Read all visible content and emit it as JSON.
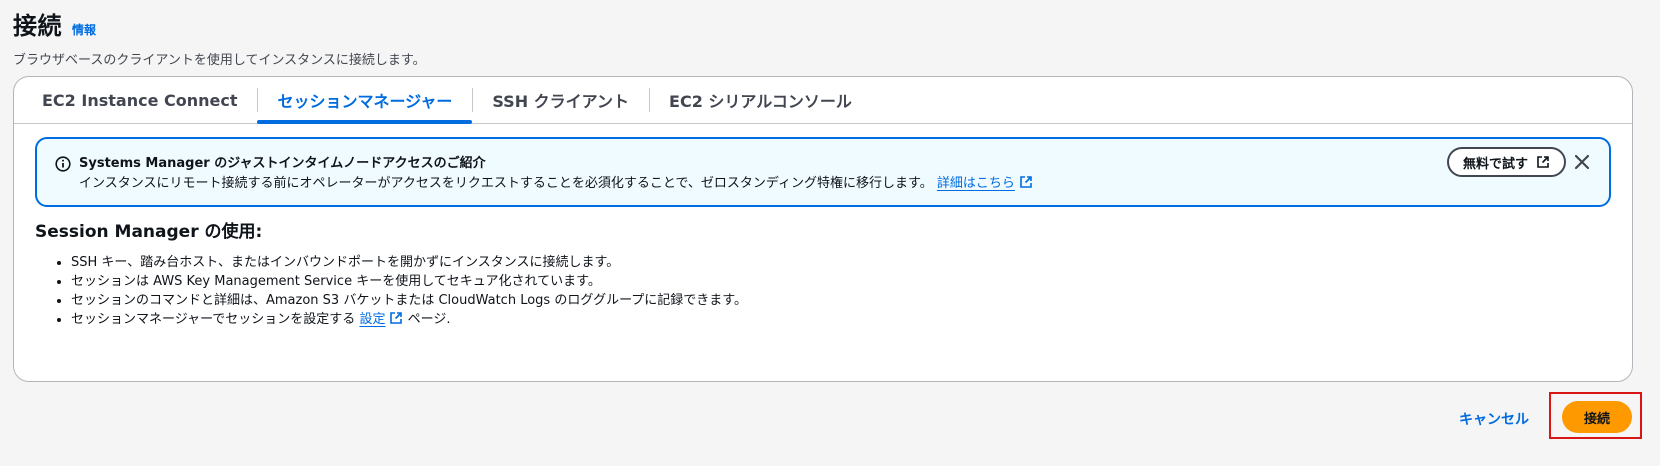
{
  "header": {
    "title": "接続",
    "info_link": "情報",
    "description": "ブラウザベースのクライアントを使用してインスタンスに接続します。"
  },
  "tabs": [
    {
      "label": "EC2 Instance Connect",
      "active": false
    },
    {
      "label": "セッションマネージャー",
      "active": true
    },
    {
      "label": "SSH クライアント",
      "active": false
    },
    {
      "label": "EC2 シリアルコンソール",
      "active": false
    }
  ],
  "alert": {
    "title": "Systems Manager のジャストインタイムノードアクセスのご紹介",
    "body": "インスタンスにリモート接続する前にオペレーターがアクセスをリクエストすることを必須化することで、ゼロスタンディング特権に移行します。",
    "learn_more": "詳細はこちら",
    "try_button": "無料で試す",
    "info_icon": "info-circle-icon",
    "close_icon": "close-icon"
  },
  "session_manager": {
    "title": "Session Manager の使用:",
    "bullets": [
      "SSH キー、踏み台ホスト、またはインバウンドポートを開かずにインスタンスに接続します。",
      "セッションは AWS Key Management Service キーを使用してセキュア化されています。",
      "セッションのコマンドと詳細は、Amazon S3 バケットまたは CloudWatch Logs のロググループに記録できます。"
    ],
    "last_bullet_prefix": "セッションマネージャーでセッションを設定する",
    "last_bullet_link": "設定",
    "last_bullet_suffix": "ページ."
  },
  "footer": {
    "cancel": "キャンセル",
    "connect": "接続"
  },
  "colors": {
    "accent": "#006ce0",
    "primary_button": "#ff9900",
    "highlight": "#d91515"
  }
}
